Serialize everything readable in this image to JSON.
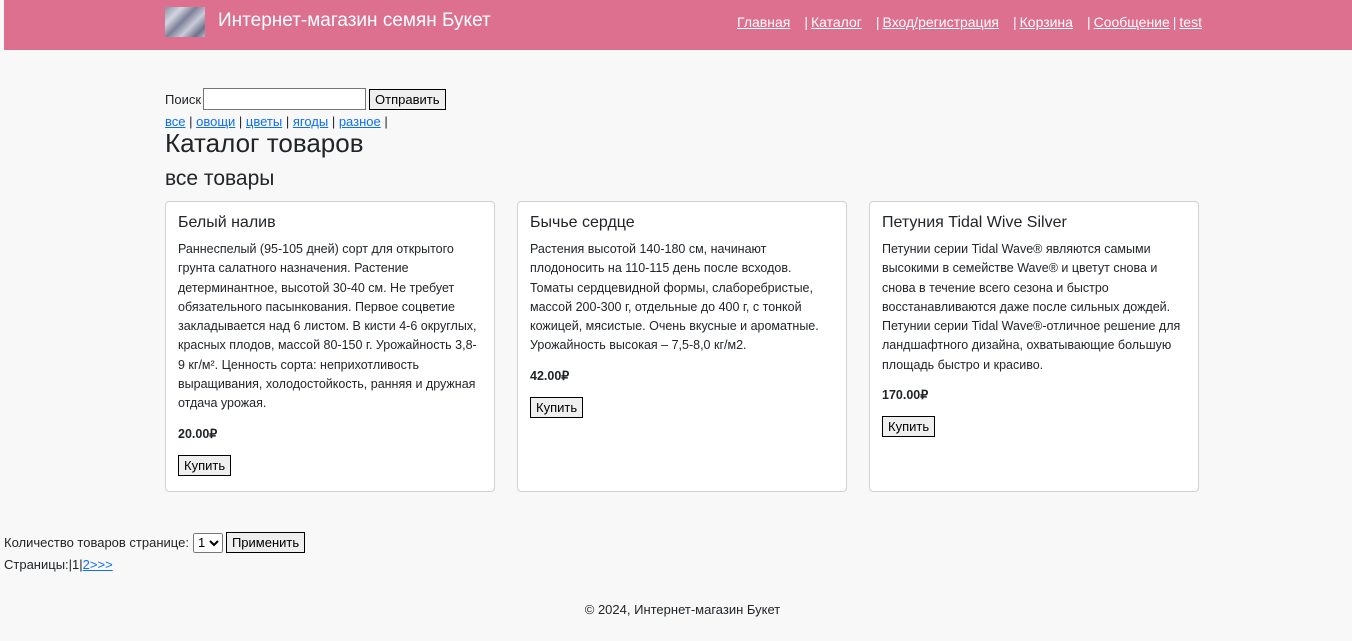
{
  "header": {
    "brand": "Интернет-магазин семян Букет",
    "nav": {
      "home": "Главная",
      "catalog": "Каталог",
      "login": "Вход/регистрация",
      "cart": "Корзина",
      "message": "Сообщение",
      "user": "test"
    }
  },
  "search": {
    "label": "Поиск",
    "value": "",
    "submit_label": "Отправить"
  },
  "categories": [
    "все",
    "овощи",
    "цветы",
    "ягоды",
    "разное"
  ],
  "page_title": "Каталог товаров",
  "section_title": "все товары",
  "currency": "₽",
  "products": [
    {
      "name": "Белый налив",
      "description": "Раннеспелый (95-105 дней) сорт для открытого грунта салатного назначения. Растение детерминантное, высотой 30-40 см. Не требует обязательного пасынкования. Первое соцветие закладывается над 6 листом. В кисти 4-6 округлых, красных плодов, массой 80-150 г. Урожайность 3,8-9 кг/м². Ценность сорта: неприхотливость выращивания, холодостойкость, ранняя и дружная отдача урожая.",
      "price": "20.00₽",
      "buy_label": "Купить"
    },
    {
      "name": "Бычье сердце",
      "description": "Растения высотой 140-180 см, начинают плодоносить на 110-115 день после всходов. Томаты сердцевидной формы, слаборебристые, массой 200-300 г, отдельные до 400 г, с тонкой кожицей, мясистые. Очень вкусные и ароматные. Урожайность высокая – 7,5-8,0 кг/м2.",
      "price": "42.00₽",
      "buy_label": "Купить"
    },
    {
      "name": "Петуния Tidal Wive Silver",
      "description": "Петунии серии Tidal Wave® являются самыми высокими в семействе Wave® и цветут снова и снова в течение всего сезона и быстро восстанавливаются даже после сильных дождей. Петунии серии Tidal Wave®-отличное решение для ландшафтного дизайна, охватывающие большую площадь быстро и красиво.",
      "price": "170.00₽",
      "buy_label": "Купить"
    }
  ],
  "pagination": {
    "per_page_label": "Количество товаров странице:",
    "per_page_value": "1",
    "apply_label": "Применить",
    "pages_label": "Страницы:",
    "current_page": "1",
    "next_page": "2",
    "next_arrow": ">>>"
  },
  "footer": "© 2024, Интернет-магазин Букет",
  "colors": {
    "header_bg": "#dc708e",
    "link": "#0d6efd",
    "page_bg": "#f8f8f8"
  }
}
